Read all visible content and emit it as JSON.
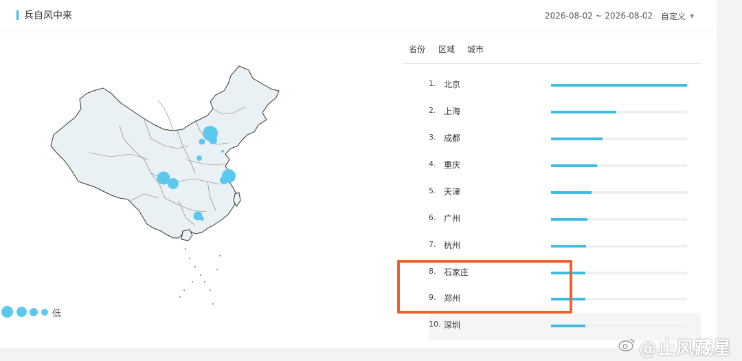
{
  "header": {
    "title": "兵自风中来",
    "date_range": "2026-08-02 ~ 2026-08-02",
    "custom_label": "自定义"
  },
  "tabs": [
    {
      "label": "省份"
    },
    {
      "label": "区域"
    },
    {
      "label": "城市"
    }
  ],
  "legend": {
    "high_label": "",
    "low_label": "低"
  },
  "ranking": [
    {
      "rank": "1.",
      "city": "北京",
      "share": 1.0
    },
    {
      "rank": "2.",
      "city": "上海",
      "share": 0.48
    },
    {
      "rank": "3.",
      "city": "成都",
      "share": 0.38
    },
    {
      "rank": "4.",
      "city": "重庆",
      "share": 0.34
    },
    {
      "rank": "5.",
      "city": "天津",
      "share": 0.3
    },
    {
      "rank": "6.",
      "city": "广州",
      "share": 0.27
    },
    {
      "rank": "7.",
      "city": "杭州",
      "share": 0.26
    },
    {
      "rank": "8.",
      "city": "石家庄",
      "share": 0.25
    },
    {
      "rank": "9.",
      "city": "郑州",
      "share": 0.25
    },
    {
      "rank": "10.",
      "city": "深圳",
      "share": 0.25
    }
  ],
  "watermark": "@止风藏星",
  "colors": {
    "accent": "#3ebde0",
    "highlight": "#f1602b",
    "map_fill": "#e9f1f4",
    "bubble": "#5cc8ee"
  }
}
